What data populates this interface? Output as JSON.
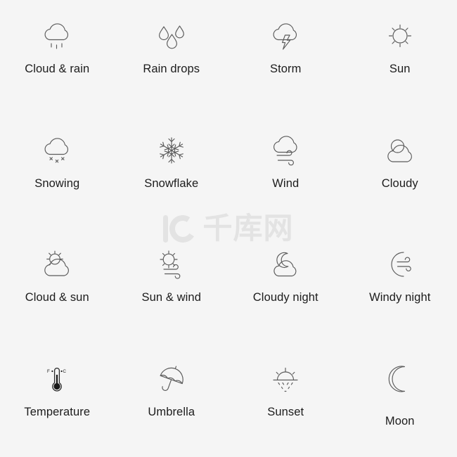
{
  "page": {
    "background_color": "#f5f5f5",
    "icon_stroke_color": "#5b5b5b",
    "label_color": "#1c1c1c",
    "columns": 4,
    "rows": 4
  },
  "watermark": {
    "logo_text": "IC",
    "text": "千库网",
    "color": "#e3e3e3"
  },
  "icons": [
    {
      "id": "cloud-rain",
      "label": "Cloud & rain",
      "icon_name": "cloud-rain-icon"
    },
    {
      "id": "rain-drops",
      "label": "Rain drops",
      "icon_name": "rain-drops-icon"
    },
    {
      "id": "storm",
      "label": "Storm",
      "icon_name": "storm-icon"
    },
    {
      "id": "sun",
      "label": "Sun",
      "icon_name": "sun-icon"
    },
    {
      "id": "snowing",
      "label": "Snowing",
      "icon_name": "cloud-snow-icon"
    },
    {
      "id": "snowflake",
      "label": "Snowflake",
      "icon_name": "snowflake-icon"
    },
    {
      "id": "wind",
      "label": "Wind",
      "icon_name": "cloud-wind-icon"
    },
    {
      "id": "cloudy",
      "label": "Cloudy",
      "icon_name": "cloudy-icon"
    },
    {
      "id": "cloud-sun",
      "label": "Cloud & sun",
      "icon_name": "cloud-sun-icon"
    },
    {
      "id": "sun-wind",
      "label": "Sun & wind",
      "icon_name": "sun-wind-icon"
    },
    {
      "id": "cloudy-night",
      "label": "Cloudy night",
      "icon_name": "moon-cloud-icon"
    },
    {
      "id": "windy-night",
      "label": "Windy night",
      "icon_name": "moon-wind-icon"
    },
    {
      "id": "temperature",
      "label": "Temperature",
      "icon_name": "thermometer-icon",
      "scale_left": "F",
      "scale_right": "C"
    },
    {
      "id": "umbrella",
      "label": "Umbrella",
      "icon_name": "umbrella-icon"
    },
    {
      "id": "sunset",
      "label": "Sunset",
      "icon_name": "sunset-icon"
    },
    {
      "id": "moon",
      "label": "Moon",
      "icon_name": "moon-icon"
    }
  ]
}
